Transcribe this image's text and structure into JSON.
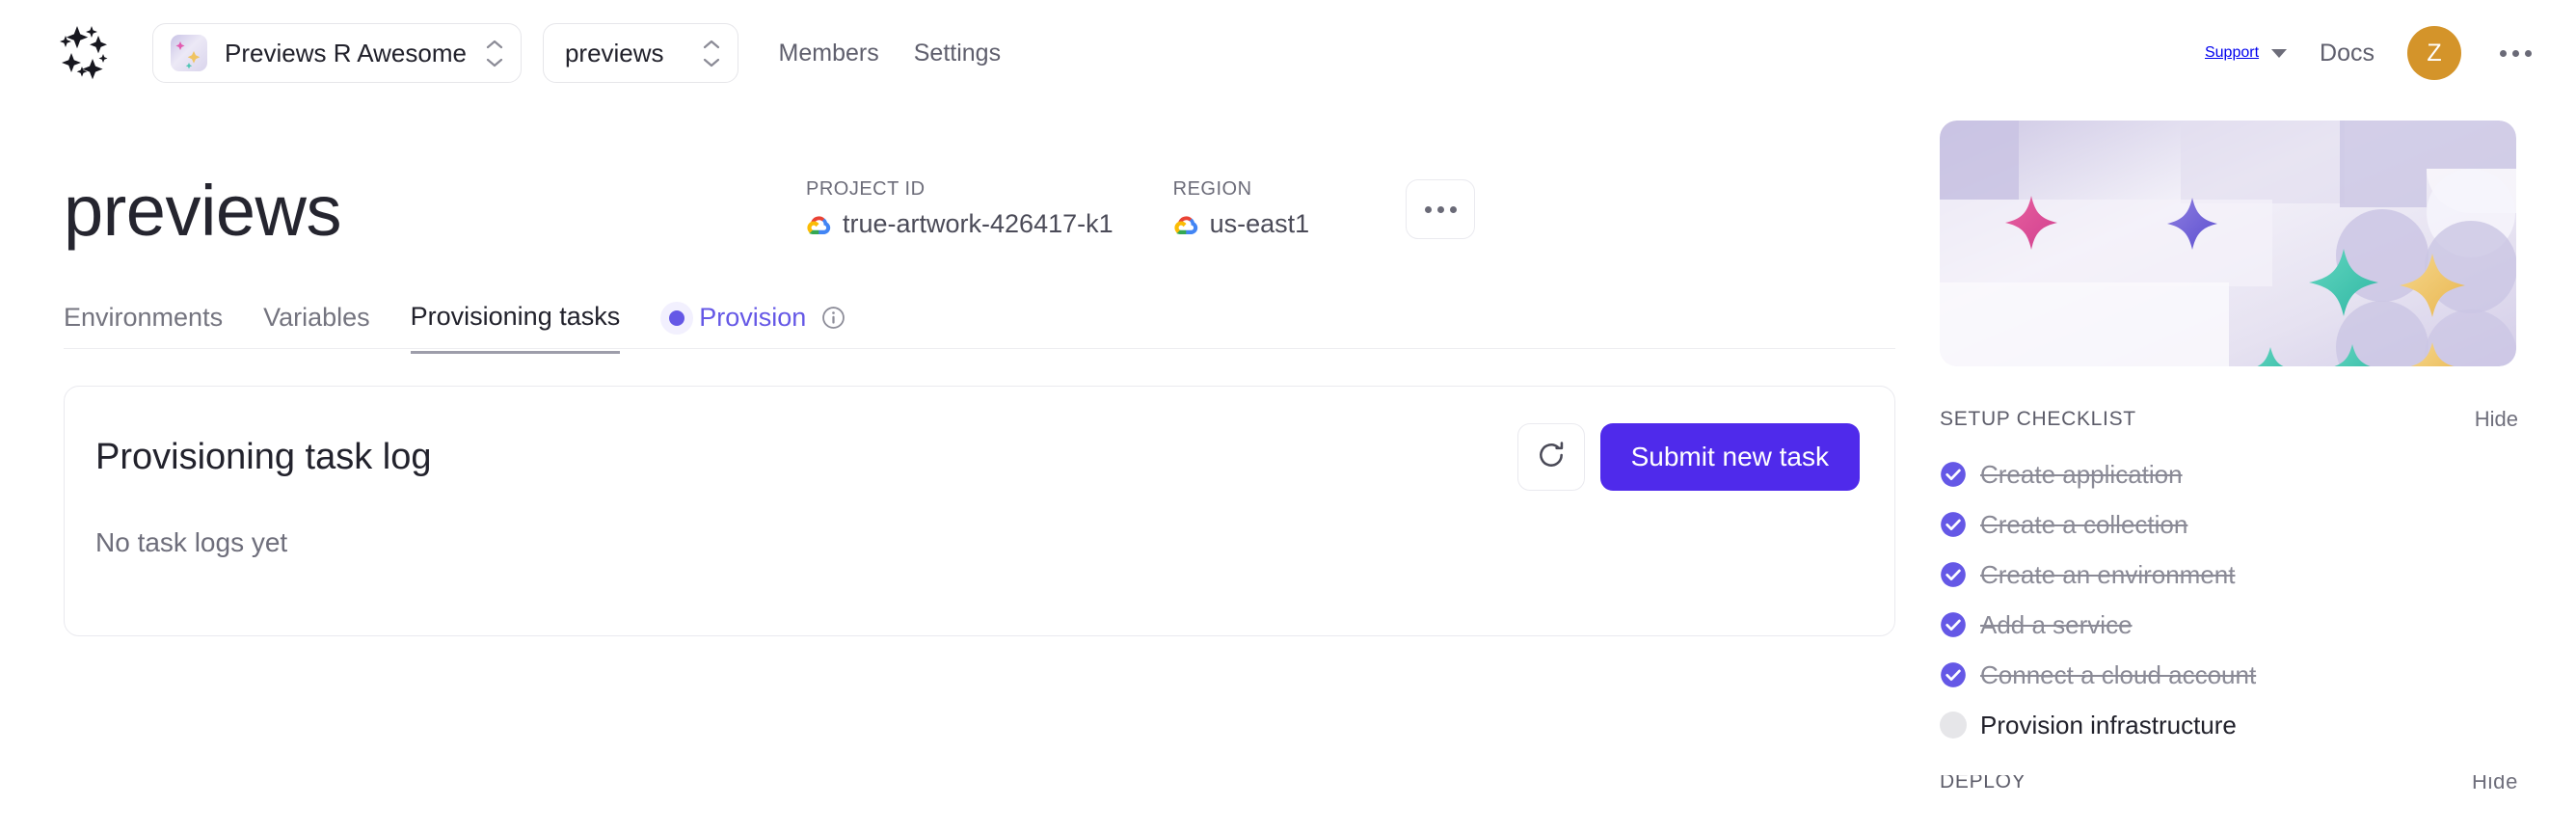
{
  "topbar": {
    "logo_name": "sparkle-cluster-logo",
    "org_switcher": {
      "label": "Previews R Awesome",
      "thumb_name": "app-thumbnail"
    },
    "project_switcher": {
      "label": "previews"
    },
    "nav": [
      {
        "label": "Members",
        "name": "members"
      },
      {
        "label": "Settings",
        "name": "settings"
      }
    ],
    "right": {
      "support_label": "Support",
      "docs_label": "Docs",
      "avatar_initial": "Z",
      "avatar_color": "#d4942a",
      "more_label": "more-options"
    }
  },
  "page": {
    "title": "previews",
    "meta": [
      {
        "label": "PROJECT ID",
        "value": "true-artwork-426417-k1",
        "icon": "google-cloud-icon"
      },
      {
        "label": "REGION",
        "value": "us-east1",
        "icon": "google-cloud-icon"
      }
    ],
    "more_button_label": "more-actions"
  },
  "tabs": {
    "items": [
      {
        "label": "Environments",
        "active": false
      },
      {
        "label": "Variables",
        "active": false
      },
      {
        "label": "Provisioning tasks",
        "active": true
      }
    ],
    "provision": {
      "label": "Provision",
      "color": "#6558e6",
      "info_tooltip": "info"
    }
  },
  "card": {
    "title": "Provisioning task log",
    "refresh_label": "refresh",
    "submit_label": "Submit new task",
    "submit_color": "#4f2aeb",
    "empty_text": "No task logs yet"
  },
  "sidebar": {
    "banner_name": "decorative-sparkles-banner",
    "checklist": {
      "title": "SETUP CHECKLIST",
      "hide_label": "Hide",
      "items": [
        {
          "label": "Create application",
          "done": true
        },
        {
          "label": "Create a collection",
          "done": true
        },
        {
          "label": "Create an environment",
          "done": true
        },
        {
          "label": "Add a service",
          "done": true
        },
        {
          "label": "Connect a cloud account",
          "done": true
        },
        {
          "label": "Provision infrastructure",
          "done": false
        }
      ]
    },
    "next_section": {
      "title": "DEPLOY",
      "hide_label": "Hide"
    }
  },
  "colors": {
    "accent_purple": "#4f2aeb",
    "link_purple": "#6558e6",
    "avatar_amber": "#d4942a",
    "text_dark": "#21212b",
    "text_muted": "#6e6e7b",
    "border": "#eaeaef"
  }
}
